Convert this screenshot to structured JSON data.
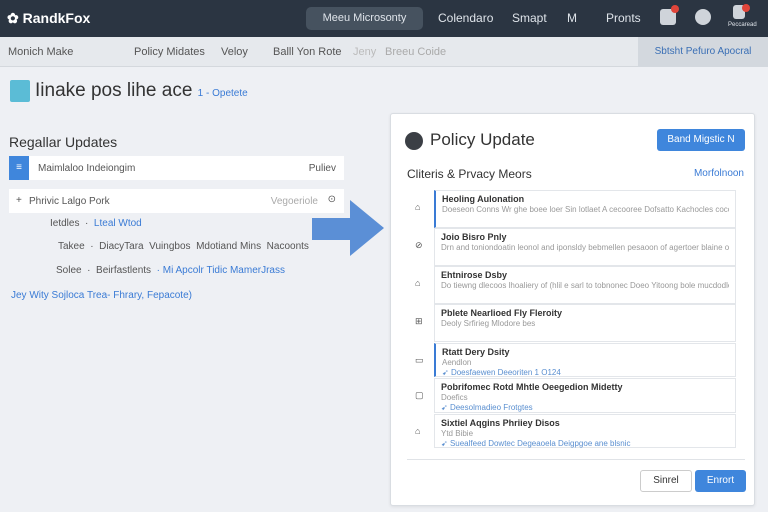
{
  "app": {
    "name": "RandkFox"
  },
  "topnav": {
    "active": "Meeu Microsonty",
    "items": [
      "Colendaro",
      "Smapt",
      "M",
      "Pronts"
    ],
    "user_label": "Peccaread"
  },
  "subnav": {
    "items": [
      "Monich Make",
      "Policy Midates",
      "Veloy",
      "Balll Yon Rote",
      "Jeny",
      "Breeu Coide"
    ],
    "action": "Sbtsht Pefuro Apocral"
  },
  "page": {
    "title": "Iinake pos lihe ace",
    "badge": "1 - Opetete"
  },
  "left": {
    "heading": "Regallar Updates",
    "card1": {
      "label": "Maimlaloo Indeiongim",
      "right": "Puliev"
    },
    "card2": {
      "label": "Phrivic Lalgo Pork",
      "right": "Vegoeriole"
    },
    "rows": [
      {
        "label": "Ietdles",
        "values": [
          "Lteal Wtod"
        ]
      },
      {
        "label": "Takee",
        "values": [
          "DiacyTara",
          "Vuingbos",
          "Mdotiand Mins",
          "Nacoonts"
        ]
      },
      {
        "label": "Solee",
        "values": [
          "Beirfastlents",
          "Mi Apcolr Tidic MamerJrass"
        ]
      }
    ],
    "footer_link": "Jey Wity Sojloca Trea- Fhrary, Fepacote)"
  },
  "panel": {
    "title": "Policy Update",
    "button": "Band Migstic N",
    "subtitle": "Cliteris & Prvacy Meors",
    "link": "Morfolnoon",
    "items": [
      {
        "title": "Heoling Aulonation",
        "desc": "Doeseon Conns Wr ghe boee loer Sin lotlaet A cecooree Dofsatto Kachocles cocoocuSetakb lone Aapeny Ioe",
        "link": ""
      },
      {
        "title": "Joio Bisro Pnly",
        "desc": "Drn and toniondoatin leonol and iponsldy bebmellen pesaoon of agertoer blaine oodir eal-gresesplas",
        "link": ""
      },
      {
        "title": "Ehtnirose Dsby",
        "desc": "Do tiewng dlecoos lhoaliery of (hlil e sarl to tobnonec Doeo Yitoong bole mucdodley",
        "link": ""
      },
      {
        "title": "Pblete Nearlioed Fly Fleroity",
        "desc": "Deoly Srfirieg Mlodore bes",
        "link": ""
      },
      {
        "title": "Rtatt Dery Dsity",
        "desc": "Aendlon",
        "link": "Doesfaewen Deeoriten 1 O124"
      },
      {
        "title": "Pobrifomec Rotd Mhtle Oeegedion Midetty",
        "desc": "Doefics",
        "link": "Deesolmadieo Frotgtes"
      },
      {
        "title": "Sixtiel Aqgins Phriiey Disos",
        "desc": "Ytd Bibie",
        "link": "Suealfeed Dowtec Degeaoela Deigpgoe ane blsnic"
      }
    ],
    "cancel": "Sinrel",
    "confirm": "Enrort"
  },
  "colors": {
    "accent": "#3f86dc",
    "topbar": "#2b3542"
  }
}
